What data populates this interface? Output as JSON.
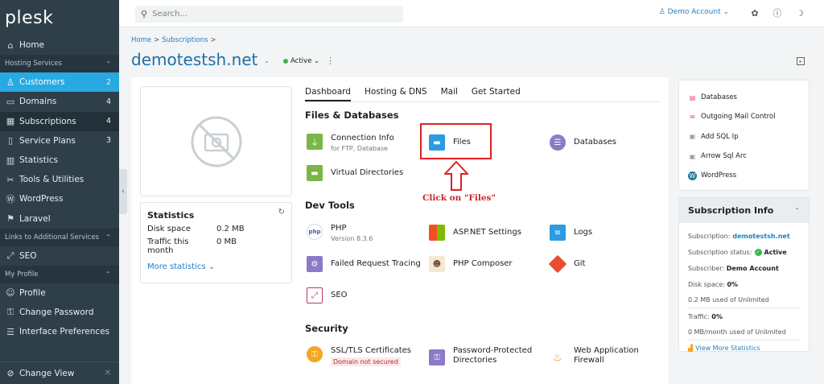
{
  "app": {
    "logo": "plesk"
  },
  "search": {
    "placeholder": "Search..."
  },
  "account": {
    "label": "Demo Account ⌄"
  },
  "sidebar": {
    "items": [
      {
        "label": "Home",
        "icon": "home-icon",
        "glyph": "⌂"
      },
      {
        "section": "Hosting Services"
      },
      {
        "label": "Customers",
        "count": "2",
        "icon": "user-icon",
        "glyph": "♙"
      },
      {
        "label": "Domains",
        "count": "4",
        "icon": "monitor-icon",
        "glyph": "▭"
      },
      {
        "label": "Subscriptions",
        "count": "4",
        "icon": "grid-icon",
        "glyph": "▦"
      },
      {
        "label": "Service Plans",
        "count": "3",
        "icon": "book-icon",
        "glyph": "▯"
      },
      {
        "label": "Statistics",
        "icon": "chart-icon",
        "glyph": "▥"
      },
      {
        "label": "Tools & Utilities",
        "icon": "tools-icon",
        "glyph": "✂"
      },
      {
        "label": "WordPress",
        "icon": "wordpress-icon",
        "glyph": "Ⓦ"
      },
      {
        "label": "Laravel",
        "icon": "laravel-icon",
        "glyph": "⚑"
      },
      {
        "section": "Links to Additional Services"
      },
      {
        "label": "SEO",
        "icon": "seo-icon",
        "glyph": "⤢"
      },
      {
        "section": "My Profile"
      },
      {
        "label": "Profile",
        "icon": "profile-icon",
        "glyph": "☺"
      },
      {
        "label": "Change Password",
        "icon": "key-icon",
        "glyph": "⚿"
      },
      {
        "label": "Interface Preferences",
        "icon": "preferences-icon",
        "glyph": "☰"
      }
    ],
    "change_view": "Change View"
  },
  "breadcrumb": {
    "home": "Home",
    "subscriptions": "Subscriptions"
  },
  "domain": {
    "name": "demotestsh.net",
    "status": "Active ⌄"
  },
  "stats": {
    "title": "Statistics",
    "disk_label": "Disk space",
    "disk_value": "0.2 MB",
    "traffic_label": "Traffic this month",
    "traffic_value": "0 MB",
    "more": "More statistics ⌄"
  },
  "tabs": [
    "Dashboard",
    "Hosting & DNS",
    "Mail",
    "Get Started"
  ],
  "sections": {
    "files": "Files & Databases",
    "dev": "Dev Tools",
    "security": "Security"
  },
  "tools": {
    "connection_info": {
      "name": "Connection Info",
      "sub": "for FTP, Database"
    },
    "files": {
      "name": "Files"
    },
    "databases": {
      "name": "Databases"
    },
    "virtual_dirs": {
      "name": "Virtual Directories"
    },
    "php": {
      "name": "PHP",
      "sub": "Version 8.3.6"
    },
    "aspnet": {
      "name": "ASP.NET Settings"
    },
    "logs": {
      "name": "Logs"
    },
    "failed_req": {
      "name": "Failed Request Tracing"
    },
    "composer": {
      "name": "PHP Composer"
    },
    "git": {
      "name": "Git"
    },
    "seo": {
      "name": "SEO"
    },
    "ssl": {
      "name": "SSL/TLS Certificates",
      "warn": "Domain not secured"
    },
    "pwd_dirs": {
      "name": "Password-Protected Directories"
    },
    "waf": {
      "name": "Web Application Firewall"
    }
  },
  "annotation": {
    "text": "Click on \"Files\""
  },
  "right_links": [
    {
      "label": "Databases",
      "icon": "database-icon",
      "color": "#e0526b",
      "glyph": "▤"
    },
    {
      "label": "Outgoing Mail Control",
      "icon": "mail-icon",
      "color": "#e05a5a",
      "glyph": "✉"
    },
    {
      "label": "Add SQL Ip",
      "icon": "window-icon",
      "color": "#8a9aa4",
      "glyph": "▣"
    },
    {
      "label": "Arrow Sql Arc",
      "icon": "window-icon",
      "color": "#8a9aa4",
      "glyph": "▣"
    },
    {
      "label": "WordPress",
      "icon": "wordpress-icon",
      "color": "#21759b",
      "glyph": "W"
    }
  ],
  "subscription_info": {
    "title": "Subscription Info",
    "subscription_label": "Subscription:",
    "subscription_value": "demotestsh.net",
    "status_label": "Subscription status:",
    "status_value": "Active",
    "subscriber_label": "Subscriber:",
    "subscriber_value": "Demo Account",
    "disk_label": "Disk space:",
    "disk_value": "0%",
    "disk_detail": "0.2 MB used of Unlimited",
    "traffic_label": "Traffic:",
    "traffic_value": "0%",
    "traffic_detail": "0 MB/month used of Unlimited",
    "more_link": "View More Statistics"
  }
}
